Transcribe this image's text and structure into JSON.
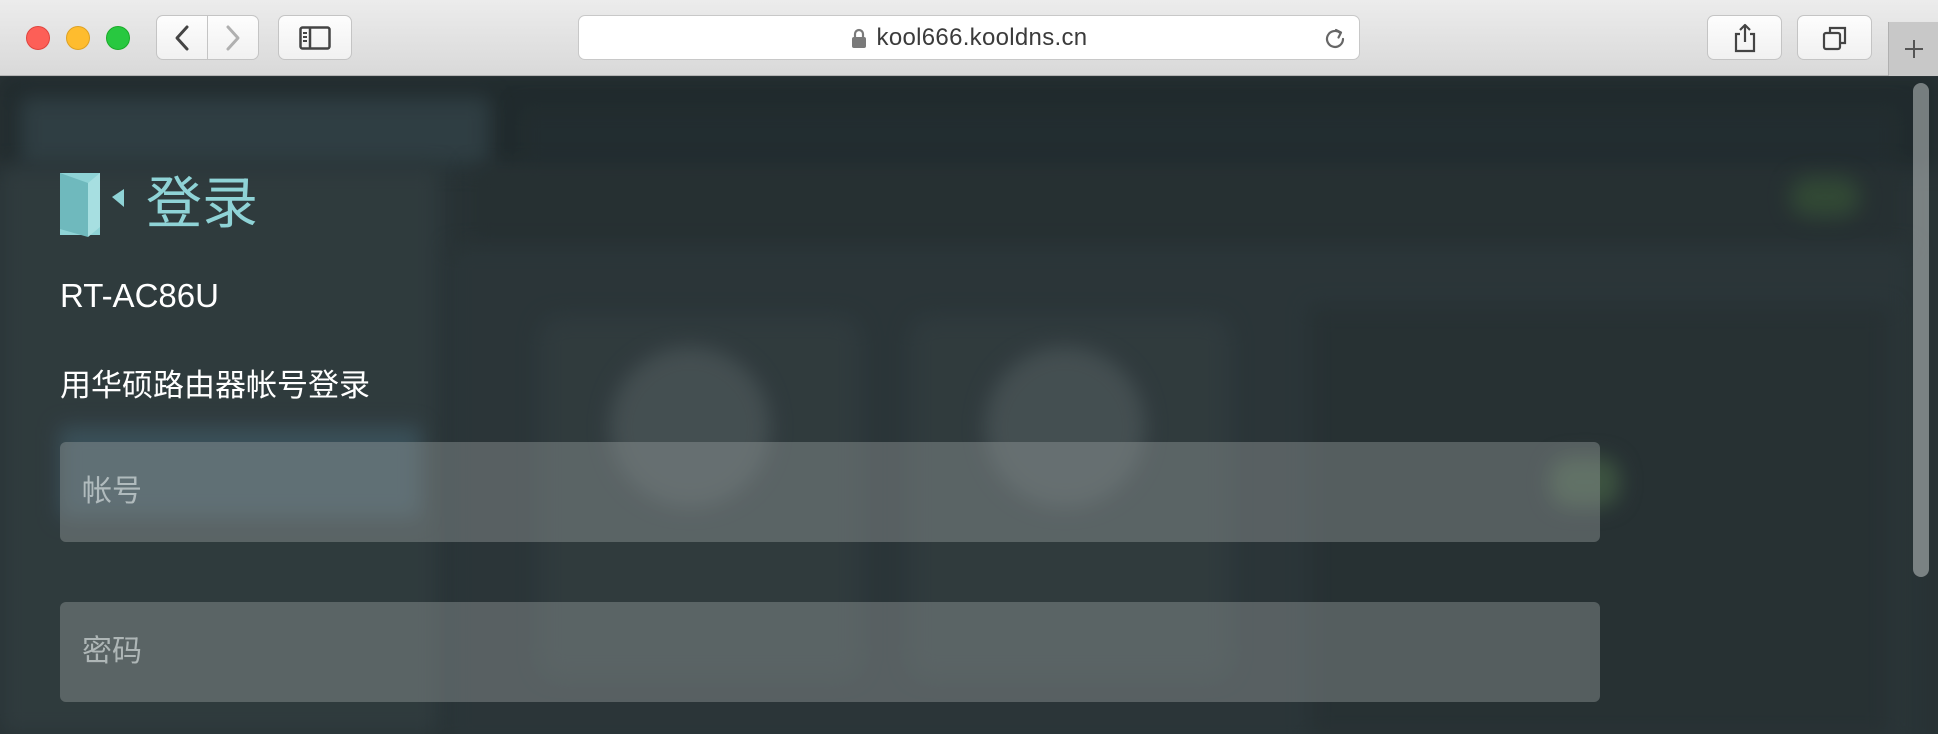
{
  "browser": {
    "url": "kool666.kooldns.cn",
    "colors": {
      "close": "#fd5f57",
      "minimize": "#febc2e",
      "maximize": "#28c840"
    },
    "icons": [
      "back-icon",
      "forward-icon",
      "sidebar-icon",
      "lock-icon",
      "reload-icon",
      "share-icon",
      "tabs-icon",
      "plus-icon"
    ]
  },
  "login": {
    "title": "登录",
    "model": "RT-AC86U",
    "subtitle": "用华硕路由器帐号登录",
    "username_placeholder": "帐号",
    "password_placeholder": "密码",
    "accent_color": "#8fd3d6"
  }
}
